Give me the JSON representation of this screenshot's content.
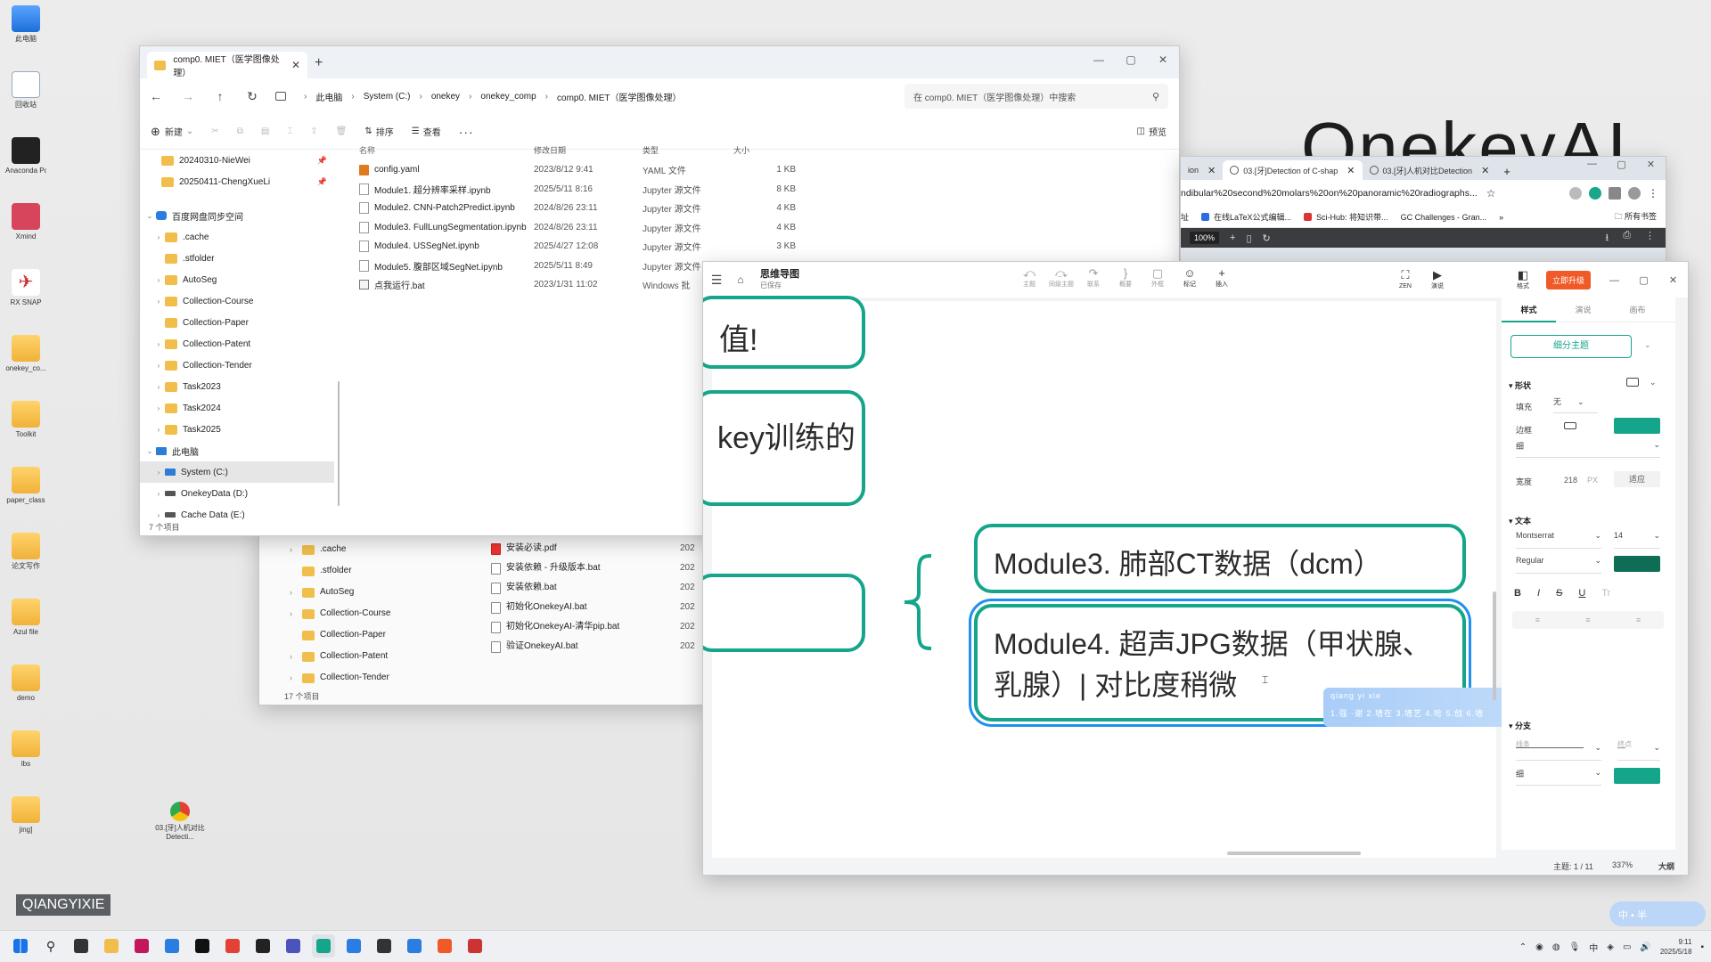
{
  "desktop": {
    "brand_text": "OnekeyAI",
    "icons": [
      {
        "label": "此电脑",
        "kind": "pc"
      },
      {
        "label": "回收站",
        "kind": "bin"
      },
      {
        "label": "Anaconda Powershe...",
        "kind": "term"
      },
      {
        "label": "Xmind",
        "kind": "mind"
      },
      {
        "label": "RX SNAP",
        "kind": "snap"
      },
      {
        "label": "onekey_co...",
        "kind": "folder"
      },
      {
        "label": "Toolkit",
        "kind": "folder"
      },
      {
        "label": "paper_class",
        "kind": "folder"
      },
      {
        "label": "论文写作",
        "kind": "folder"
      },
      {
        "label": "Azul file",
        "kind": "folder"
      },
      {
        "label": "demo",
        "kind": "folder"
      },
      {
        "label": "lbs",
        "kind": "folder"
      },
      {
        "label": "jing]",
        "kind": "folder"
      }
    ],
    "chrome_shortcut": "03.[牙]人机对比Detecti...",
    "watermark_label": "QIANGYIXIE",
    "ime_widget": "中 • 半"
  },
  "explorer": {
    "tab_title": "comp0. MIET（医学图像处理）",
    "breadcrumbs": [
      "此电脑",
      "System (C:)",
      "onekey",
      "onekey_comp",
      "comp0. MIET（医学图像处理）"
    ],
    "search_placeholder": "在 comp0. MIET（医学图像处理）中搜索",
    "toolbar": {
      "new_label": "新建",
      "sort_label": "排序",
      "view_label": "查看",
      "more_label": "···",
      "preview_label": "预览"
    },
    "nav": [
      {
        "label": "20240310-NieWei",
        "type": "folder",
        "pinned": true
      },
      {
        "label": "20250411-ChengXueLi",
        "type": "folder",
        "pinned": true
      },
      {
        "label": "",
        "type": "spacer"
      },
      {
        "label": "百度网盘同步空间",
        "type": "cloud",
        "expanded": true
      },
      {
        "label": ".cache",
        "type": "folder",
        "chev": true
      },
      {
        "label": ".stfolder",
        "type": "folder"
      },
      {
        "label": "AutoSeg",
        "type": "folder",
        "chev": true
      },
      {
        "label": "Collection-Course",
        "type": "folder",
        "chev": true
      },
      {
        "label": "Collection-Paper",
        "type": "folder"
      },
      {
        "label": "Collection-Patent",
        "type": "folder",
        "chev": true
      },
      {
        "label": "Collection-Tender",
        "type": "folder",
        "chev": true
      },
      {
        "label": "Task2023",
        "type": "folder",
        "chev": true
      },
      {
        "label": "Task2024",
        "type": "folder",
        "chev": true
      },
      {
        "label": "Task2025",
        "type": "folder",
        "chev": true
      },
      {
        "label": "此电脑",
        "type": "pc",
        "expanded": true
      },
      {
        "label": "System (C:)",
        "type": "drive-sys",
        "chev": true,
        "selected": true
      },
      {
        "label": "OnekeyData (D:)",
        "type": "drive",
        "chev": true
      },
      {
        "label": "Cache Data (E:)",
        "type": "drive",
        "chev": true
      }
    ],
    "columns": {
      "name": "名称",
      "modified": "修改日期",
      "type": "类型",
      "size": "大小"
    },
    "files": [
      {
        "name": "config.yaml",
        "modified": "2023/8/12 9:41",
        "type": "YAML 文件",
        "size": "1 KB",
        "icon": "yaml"
      },
      {
        "name": "Module1. 超分辨率采样.ipynb",
        "modified": "2025/5/11 8:16",
        "type": "Jupyter 源文件",
        "size": "8 KB",
        "icon": "nb"
      },
      {
        "name": "Module2. CNN-Patch2Predict.ipynb",
        "modified": "2024/8/26 23:11",
        "type": "Jupyter 源文件",
        "size": "4 KB",
        "icon": "nb"
      },
      {
        "name": "Module3. FullLungSegmentation.ipynb",
        "modified": "2024/8/26 23:11",
        "type": "Jupyter 源文件",
        "size": "4 KB",
        "icon": "nb"
      },
      {
        "name": "Module4. USSegNet.ipynb",
        "modified": "2025/4/27 12:08",
        "type": "Jupyter 源文件",
        "size": "3 KB",
        "icon": "nb"
      },
      {
        "name": "Module5. 腹部区域SegNet.ipynb",
        "modified": "2025/5/11 8:49",
        "type": "Jupyter 源文件",
        "size": "",
        "icon": "nb"
      },
      {
        "name": "点我运行.bat",
        "modified": "2023/1/31 11:02",
        "type": "Windows 批",
        "size": "",
        "icon": "bat"
      }
    ],
    "status_count": "7 个项目"
  },
  "explorer2": {
    "nav": [
      {
        "label": ".cache",
        "chev": true
      },
      {
        "label": ".stfolder",
        "chev": false
      },
      {
        "label": "AutoSeg",
        "chev": true
      },
      {
        "label": "Collection-Course",
        "chev": true
      },
      {
        "label": "Collection-Paper",
        "chev": false
      },
      {
        "label": "Collection-Patent",
        "chev": true
      },
      {
        "label": "Collection-Tender",
        "chev": true
      }
    ],
    "files": [
      {
        "name": "安装必读.pdf",
        "date": "202",
        "icon": "pdf"
      },
      {
        "name": "安装依赖 - 升级版本.bat",
        "date": "202",
        "icon": "bat"
      },
      {
        "name": "安装依赖.bat",
        "date": "202",
        "icon": "bat"
      },
      {
        "name": "初始化OnekeyAI.bat",
        "date": "202",
        "icon": "bat"
      },
      {
        "name": "初始化OnekeyAI-清华pip.bat",
        "date": "202",
        "icon": "bat"
      },
      {
        "name": "验证OnekeyAI.bat",
        "date": "202",
        "icon": "bat"
      }
    ],
    "status_count": "17 个项目"
  },
  "browser": {
    "tabs": [
      {
        "label": "ion",
        "active": false
      },
      {
        "label": "03.[牙]Detection of C-shap",
        "active": true
      },
      {
        "label": "03.[牙]人机对比Detection",
        "active": false
      }
    ],
    "url": "ndibular%20second%20molars%20on%20panoramic%20radiographs...",
    "bookmarks": [
      {
        "label": "址",
        "color": "none"
      },
      {
        "label": "在线LaTeX公式编辑...",
        "color": "blue"
      },
      {
        "label": "Sci-Hub: 将知识带...",
        "color": "red"
      },
      {
        "label": "GC Challenges - Gran...",
        "color": "none"
      }
    ],
    "all_bookmarks": "所有书签",
    "pdf_zoom": "100%"
  },
  "mindmap": {
    "title": "思维导图",
    "subtitle": "已保存",
    "tools": [
      {
        "label": "主题",
        "icon": "⤺"
      },
      {
        "label": "同级主题",
        "icon": "⤼"
      },
      {
        "label": "联系",
        "icon": "↷"
      },
      {
        "label": "概要",
        "icon": "}"
      },
      {
        "label": "外框",
        "icon": "▢"
      },
      {
        "label": "标记",
        "icon": "☺"
      },
      {
        "label": "插入",
        "icon": "+"
      }
    ],
    "right_tools": [
      {
        "label": "ZEN",
        "icon": "⛶"
      },
      {
        "label": "演说",
        "icon": "▶"
      },
      {
        "label": "格式",
        "icon": "◧"
      }
    ],
    "upgrade_label": "立即升级",
    "nodes": [
      {
        "text": "值!",
        "fs": 34
      },
      {
        "text": "key训练的",
        "fs": 34
      },
      {
        "text": "",
        "fs": 34
      },
      {
        "text": "Module3. 肺部CT数据（dcm）",
        "fs": 32
      },
      {
        "text": "Module4. 超声JPG数据（甲状腺、乳腺）| 对比度稍微",
        "fs": 32
      }
    ],
    "popup": {
      "line1": "qiang yi xie",
      "line2": "1.强 ·谢  2.墙在  3.墙艺  4.呛  5.戗  6.墙",
      "right": "◂ ▸"
    },
    "panel": {
      "tabs": [
        "样式",
        "演说",
        "画布"
      ],
      "theme_button": "细分主题",
      "shape_section": "形状",
      "fill_label": "填充",
      "fill_value": "无",
      "border_label": "边框",
      "border_weight": "细",
      "width_label": "宽度",
      "width_value": "218",
      "width_unit": "PX",
      "width_fit": "适应",
      "text_section": "文本",
      "font_family": "Montserrat",
      "font_size": "14",
      "font_weight": "Regular",
      "format_buttons": [
        "B",
        "I",
        "S",
        "U",
        "Tr"
      ],
      "branch_section": "分支",
      "line_label": "线条",
      "end_label": "终点",
      "branch_weight": "细",
      "colors": {
        "accent": "#15a58a",
        "text_swatch": "#0f6c55"
      }
    },
    "status": {
      "topic": "主题: 1 / 11",
      "zoom": "337%",
      "outline": "大纲"
    }
  },
  "taskbar": {
    "time": "9:11",
    "date": "2025/5/18",
    "icons": [
      "windows",
      "search",
      "taskview",
      "explorer",
      "pointer",
      "vscode",
      "pycharm",
      "chrome",
      "terminal",
      "teams",
      "mindmap-active",
      "network",
      "cmd",
      "sdl",
      "xmind",
      "snap"
    ]
  }
}
